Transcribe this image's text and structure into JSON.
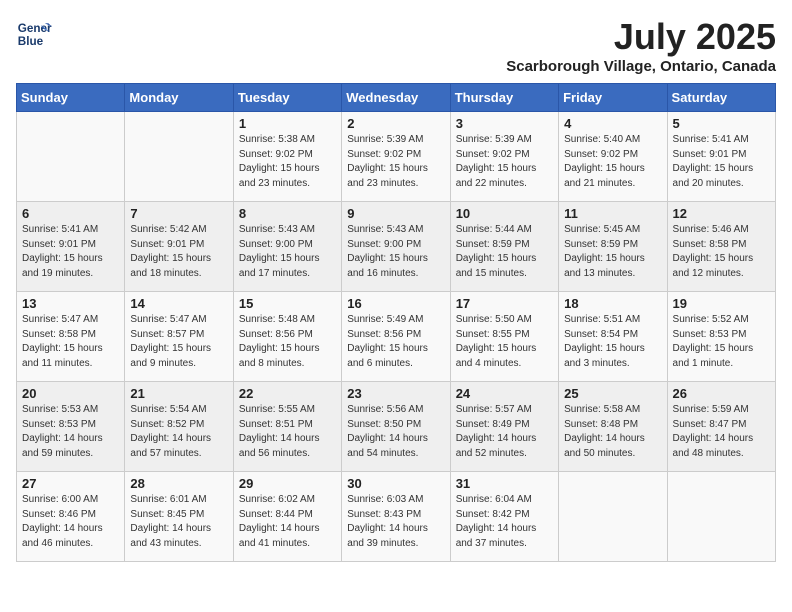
{
  "logo": {
    "line1": "General",
    "line2": "Blue"
  },
  "title": "July 2025",
  "location": "Scarborough Village, Ontario, Canada",
  "days_of_week": [
    "Sunday",
    "Monday",
    "Tuesday",
    "Wednesday",
    "Thursday",
    "Friday",
    "Saturday"
  ],
  "weeks": [
    [
      {
        "day": "",
        "info": ""
      },
      {
        "day": "",
        "info": ""
      },
      {
        "day": "1",
        "sunrise": "Sunrise: 5:38 AM",
        "sunset": "Sunset: 9:02 PM",
        "daylight": "Daylight: 15 hours and 23 minutes."
      },
      {
        "day": "2",
        "sunrise": "Sunrise: 5:39 AM",
        "sunset": "Sunset: 9:02 PM",
        "daylight": "Daylight: 15 hours and 23 minutes."
      },
      {
        "day": "3",
        "sunrise": "Sunrise: 5:39 AM",
        "sunset": "Sunset: 9:02 PM",
        "daylight": "Daylight: 15 hours and 22 minutes."
      },
      {
        "day": "4",
        "sunrise": "Sunrise: 5:40 AM",
        "sunset": "Sunset: 9:02 PM",
        "daylight": "Daylight: 15 hours and 21 minutes."
      },
      {
        "day": "5",
        "sunrise": "Sunrise: 5:41 AM",
        "sunset": "Sunset: 9:01 PM",
        "daylight": "Daylight: 15 hours and 20 minutes."
      }
    ],
    [
      {
        "day": "6",
        "sunrise": "Sunrise: 5:41 AM",
        "sunset": "Sunset: 9:01 PM",
        "daylight": "Daylight: 15 hours and 19 minutes."
      },
      {
        "day": "7",
        "sunrise": "Sunrise: 5:42 AM",
        "sunset": "Sunset: 9:01 PM",
        "daylight": "Daylight: 15 hours and 18 minutes."
      },
      {
        "day": "8",
        "sunrise": "Sunrise: 5:43 AM",
        "sunset": "Sunset: 9:00 PM",
        "daylight": "Daylight: 15 hours and 17 minutes."
      },
      {
        "day": "9",
        "sunrise": "Sunrise: 5:43 AM",
        "sunset": "Sunset: 9:00 PM",
        "daylight": "Daylight: 15 hours and 16 minutes."
      },
      {
        "day": "10",
        "sunrise": "Sunrise: 5:44 AM",
        "sunset": "Sunset: 8:59 PM",
        "daylight": "Daylight: 15 hours and 15 minutes."
      },
      {
        "day": "11",
        "sunrise": "Sunrise: 5:45 AM",
        "sunset": "Sunset: 8:59 PM",
        "daylight": "Daylight: 15 hours and 13 minutes."
      },
      {
        "day": "12",
        "sunrise": "Sunrise: 5:46 AM",
        "sunset": "Sunset: 8:58 PM",
        "daylight": "Daylight: 15 hours and 12 minutes."
      }
    ],
    [
      {
        "day": "13",
        "sunrise": "Sunrise: 5:47 AM",
        "sunset": "Sunset: 8:58 PM",
        "daylight": "Daylight: 15 hours and 11 minutes."
      },
      {
        "day": "14",
        "sunrise": "Sunrise: 5:47 AM",
        "sunset": "Sunset: 8:57 PM",
        "daylight": "Daylight: 15 hours and 9 minutes."
      },
      {
        "day": "15",
        "sunrise": "Sunrise: 5:48 AM",
        "sunset": "Sunset: 8:56 PM",
        "daylight": "Daylight: 15 hours and 8 minutes."
      },
      {
        "day": "16",
        "sunrise": "Sunrise: 5:49 AM",
        "sunset": "Sunset: 8:56 PM",
        "daylight": "Daylight: 15 hours and 6 minutes."
      },
      {
        "day": "17",
        "sunrise": "Sunrise: 5:50 AM",
        "sunset": "Sunset: 8:55 PM",
        "daylight": "Daylight: 15 hours and 4 minutes."
      },
      {
        "day": "18",
        "sunrise": "Sunrise: 5:51 AM",
        "sunset": "Sunset: 8:54 PM",
        "daylight": "Daylight: 15 hours and 3 minutes."
      },
      {
        "day": "19",
        "sunrise": "Sunrise: 5:52 AM",
        "sunset": "Sunset: 8:53 PM",
        "daylight": "Daylight: 15 hours and 1 minute."
      }
    ],
    [
      {
        "day": "20",
        "sunrise": "Sunrise: 5:53 AM",
        "sunset": "Sunset: 8:53 PM",
        "daylight": "Daylight: 14 hours and 59 minutes."
      },
      {
        "day": "21",
        "sunrise": "Sunrise: 5:54 AM",
        "sunset": "Sunset: 8:52 PM",
        "daylight": "Daylight: 14 hours and 57 minutes."
      },
      {
        "day": "22",
        "sunrise": "Sunrise: 5:55 AM",
        "sunset": "Sunset: 8:51 PM",
        "daylight": "Daylight: 14 hours and 56 minutes."
      },
      {
        "day": "23",
        "sunrise": "Sunrise: 5:56 AM",
        "sunset": "Sunset: 8:50 PM",
        "daylight": "Daylight: 14 hours and 54 minutes."
      },
      {
        "day": "24",
        "sunrise": "Sunrise: 5:57 AM",
        "sunset": "Sunset: 8:49 PM",
        "daylight": "Daylight: 14 hours and 52 minutes."
      },
      {
        "day": "25",
        "sunrise": "Sunrise: 5:58 AM",
        "sunset": "Sunset: 8:48 PM",
        "daylight": "Daylight: 14 hours and 50 minutes."
      },
      {
        "day": "26",
        "sunrise": "Sunrise: 5:59 AM",
        "sunset": "Sunset: 8:47 PM",
        "daylight": "Daylight: 14 hours and 48 minutes."
      }
    ],
    [
      {
        "day": "27",
        "sunrise": "Sunrise: 6:00 AM",
        "sunset": "Sunset: 8:46 PM",
        "daylight": "Daylight: 14 hours and 46 minutes."
      },
      {
        "day": "28",
        "sunrise": "Sunrise: 6:01 AM",
        "sunset": "Sunset: 8:45 PM",
        "daylight": "Daylight: 14 hours and 43 minutes."
      },
      {
        "day": "29",
        "sunrise": "Sunrise: 6:02 AM",
        "sunset": "Sunset: 8:44 PM",
        "daylight": "Daylight: 14 hours and 41 minutes."
      },
      {
        "day": "30",
        "sunrise": "Sunrise: 6:03 AM",
        "sunset": "Sunset: 8:43 PM",
        "daylight": "Daylight: 14 hours and 39 minutes."
      },
      {
        "day": "31",
        "sunrise": "Sunrise: 6:04 AM",
        "sunset": "Sunset: 8:42 PM",
        "daylight": "Daylight: 14 hours and 37 minutes."
      },
      {
        "day": "",
        "info": ""
      },
      {
        "day": "",
        "info": ""
      }
    ]
  ]
}
